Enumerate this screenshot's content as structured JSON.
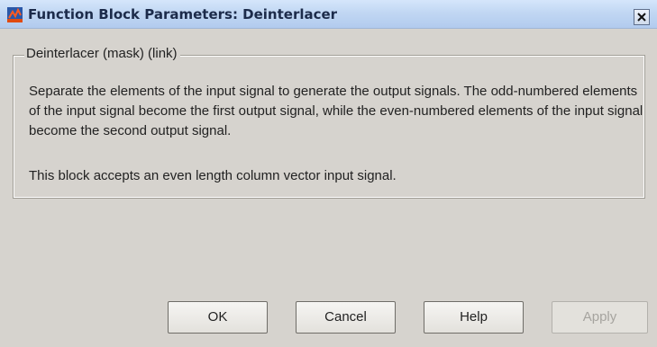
{
  "window": {
    "title": "Function Block Parameters: Deinterlacer",
    "icon": "simulink-block-icon",
    "close_icon": "close-icon"
  },
  "group": {
    "legend": "Deinterlacer (mask) (link)",
    "description": "Separate the elements of the input signal to generate the output signals. The odd-numbered elements of the input signal become the first output signal, while the even-numbered elements of the input signal become the second output signal.",
    "note": "This block accepts an even length column vector input signal."
  },
  "buttons": {
    "ok": "OK",
    "cancel": "Cancel",
    "help": "Help",
    "apply": "Apply",
    "apply_disabled": true
  },
  "colors": {
    "dialog_bg": "#d6d3ce",
    "titlebar": "#c1d7f3",
    "disabled_text": "#a6a49f"
  }
}
